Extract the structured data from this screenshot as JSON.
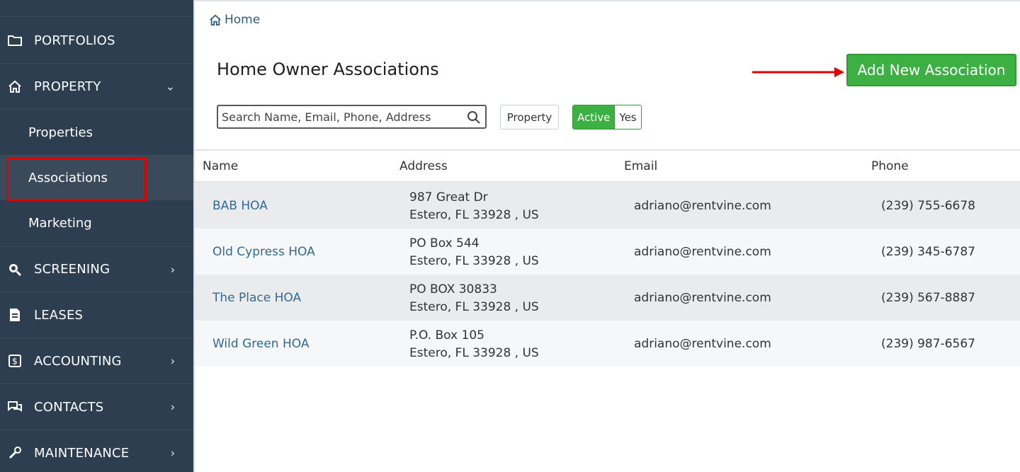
{
  "sidebar": {
    "items": [
      {
        "label": "PORTFOLIOS",
        "icon": "folder-icon"
      },
      {
        "label": "PROPERTY",
        "icon": "home-icon",
        "chevron": "⌄"
      },
      {
        "label": "SCREENING",
        "icon": "search-magnify-icon",
        "chevron": "›"
      },
      {
        "label": "LEASES",
        "icon": "document-icon"
      },
      {
        "label": "ACCOUNTING",
        "icon": "dollar-icon",
        "chevron": "›"
      },
      {
        "label": "CONTACTS",
        "icon": "chat-icon",
        "chevron": "›"
      },
      {
        "label": "MAINTENANCE",
        "icon": "wrench-icon",
        "chevron": "›"
      }
    ],
    "sub_items": [
      "Properties",
      "Associations",
      "Marketing"
    ],
    "active_sub": "Associations"
  },
  "breadcrumb": {
    "label": "Home",
    "icon": "home-icon"
  },
  "page": {
    "title": "Home Owner Associations",
    "add_button": "Add New Association"
  },
  "filters": {
    "search_placeholder": "Search Name, Email, Phone, Address",
    "property_label": "Property",
    "active_label": "Active",
    "active_value": "Yes"
  },
  "table": {
    "headers": [
      "Name",
      "Address",
      "Email",
      "Phone"
    ],
    "rows": [
      {
        "name": "BAB HOA",
        "addr1": "987 Great Dr",
        "addr2": "Estero, FL 33928 , US",
        "email": "adriano@rentvine.com",
        "phone": "(239) 755-6678"
      },
      {
        "name": "Old Cypress HOA",
        "addr1": "PO Box 544",
        "addr2": "Estero, FL 33928 , US",
        "email": "adriano@rentvine.com",
        "phone": "(239) 345-6787"
      },
      {
        "name": "The Place HOA",
        "addr1": "PO BOX 30833",
        "addr2": "Estero, FL 33928 , US",
        "email": "adriano@rentvine.com",
        "phone": "(239) 567-8887"
      },
      {
        "name": "Wild Green HOA",
        "addr1": "P.O. Box 105",
        "addr2": "Estero, FL 33928 , US",
        "email": "adriano@rentvine.com",
        "phone": "(239) 987-6567"
      }
    ]
  },
  "colors": {
    "sidebar_bg": "#2d3e50",
    "accent_green": "#3cb043",
    "link_blue": "#2f6a95",
    "highlight_red": "#e00000"
  }
}
